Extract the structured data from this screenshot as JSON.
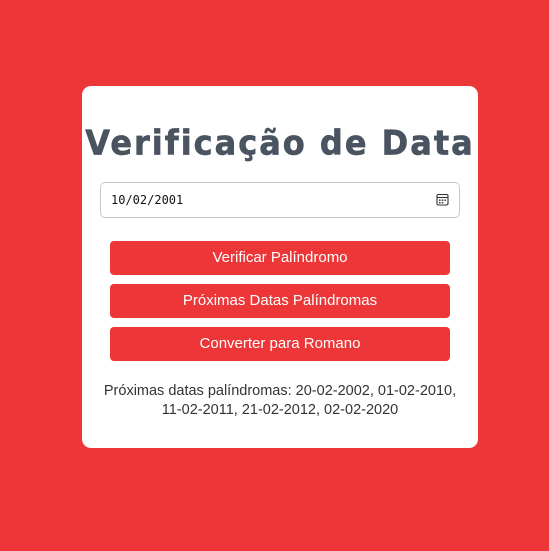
{
  "page": {
    "background_color": "#ec3638"
  },
  "card": {
    "title": "Verificação de Data",
    "date_input": {
      "value": "10/02/2001",
      "icon": "calendar-icon"
    },
    "buttons": [
      {
        "label": "Verificar Palíndromo"
      },
      {
        "label": "Próximas Datas Palíndromas"
      },
      {
        "label": "Converter para Romano"
      }
    ],
    "result": {
      "line1": "Próximas datas palíndromas: 20-02-2002, 01-02-2010,",
      "line2": "11-02-2011, 21-02-2012, 02-02-2020"
    }
  },
  "colors": {
    "accent": "#ec3638",
    "title": "#4a5461",
    "card": "#ffffff"
  }
}
